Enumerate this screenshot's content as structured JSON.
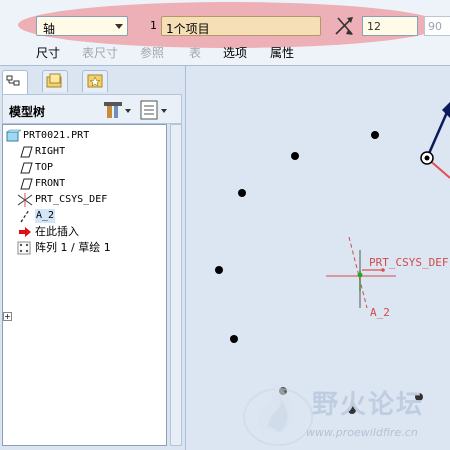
{
  "dashboard": {
    "type_select": "轴",
    "reference_number": "1",
    "reference_value": "1个项目",
    "increment_value": "12",
    "angle_value": "90",
    "tabs": [
      {
        "label": "尺寸",
        "enabled": true
      },
      {
        "label": "表尺寸",
        "enabled": false
      },
      {
        "label": "参照",
        "enabled": false
      },
      {
        "label": "表",
        "enabled": false
      },
      {
        "label": "选项",
        "enabled": true
      },
      {
        "label": "属性",
        "enabled": true
      }
    ]
  },
  "model_tree": {
    "title": "模型树",
    "nodes": [
      {
        "label": "PRT0021.PRT",
        "icon": "part-icon"
      },
      {
        "label": "RIGHT",
        "icon": "datum-plane-icon"
      },
      {
        "label": "TOP",
        "icon": "datum-plane-icon"
      },
      {
        "label": "FRONT",
        "icon": "datum-plane-icon"
      },
      {
        "label": "PRT_CSYS_DEF",
        "icon": "coordinate-system-icon"
      },
      {
        "label": "A_2",
        "icon": "datum-axis-icon",
        "selected": true
      },
      {
        "label": "在此插入",
        "icon": "insert-arrow-icon"
      },
      {
        "label": "阵列 1 / 草绘 1",
        "icon": "pattern-icon"
      }
    ]
  },
  "graphics": {
    "csys_label": "PRT_CSYS_DEF",
    "axis_label": "A_2"
  },
  "watermark": {
    "brand": "野火论坛",
    "url": "www.proewildfire.cn"
  },
  "colors": {
    "highlight": "#ec7880",
    "accent_red": "#d24a4a",
    "selection": "#d3e6f7"
  }
}
